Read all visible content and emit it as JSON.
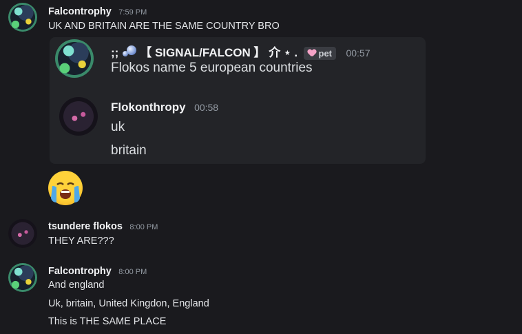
{
  "messages": [
    {
      "username": "Falcontrophy",
      "timestamp": "7:59 PM",
      "lines": [
        "UK AND BRITAIN ARE THE SAME COUNTRY BRO"
      ]
    },
    {
      "username": "tsundere flokos",
      "timestamp": "8:00 PM",
      "lines": [
        "THEY ARE???"
      ]
    },
    {
      "username": "Falcontrophy",
      "timestamp": "8:00 PM",
      "lines": [
        "And england",
        "Uk, britain, United Kingdon, England",
        "This is THE SAME PLACE"
      ]
    }
  ],
  "embed": {
    "first": {
      "name_prefix": ";;",
      "name": "【 SIGNAL/FALCON 】 介 ⋆ .",
      "tag": "pet",
      "time": "00:57",
      "text": "Flokos name 5 european countries"
    },
    "second": {
      "name": "Flokonthropy",
      "time": "00:58",
      "lines": [
        "uk",
        "britain"
      ]
    }
  },
  "reaction_emoji": "crying-face",
  "colors": {
    "background": "#1a1a1e",
    "embed_background": "#232428",
    "username": "#f2f3f5",
    "timestamp": "#949ba4"
  }
}
